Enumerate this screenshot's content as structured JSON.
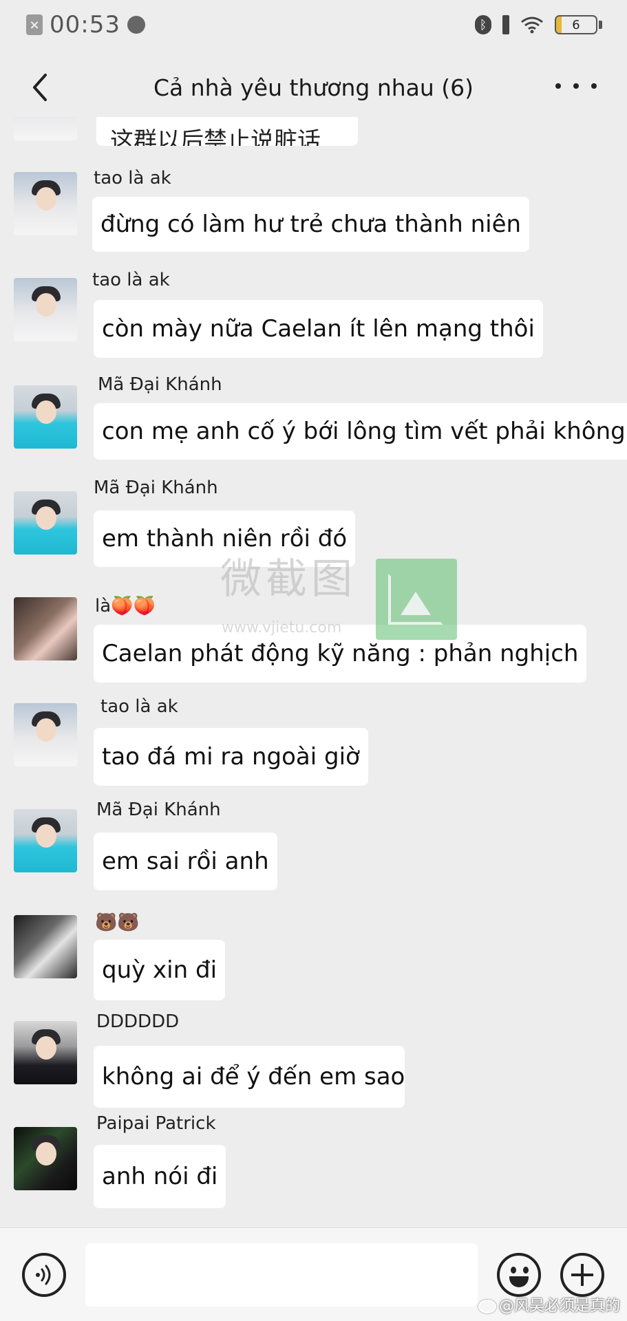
{
  "status_bar": {
    "time": "00:53",
    "battery": "6"
  },
  "nav": {
    "title": "Cả nhà yêu thương nhau (6)"
  },
  "partial_top_message": "这群以后禁止说脏话",
  "messages": [
    {
      "sender": "tao là ak",
      "text": "đừng có làm hư trẻ chưa thành niên",
      "avatar": "boy-white-shirt"
    },
    {
      "sender": "tao là ak",
      "text": "còn mày nữa  Caelan  ít lên mạng thôi",
      "avatar": "boy-white-shirt"
    },
    {
      "sender": "Mã Đại Khánh",
      "text": "con mẹ anh cố ý bới lông tìm vết phải không",
      "avatar": "boy-cyan-hoodie"
    },
    {
      "sender": "Mã Đại Khánh",
      "text": "em thành niên rồi đó",
      "avatar": "boy-cyan-hoodie"
    },
    {
      "sender": "là🍑🍑",
      "text": "Caelan phát động kỹ năng : phản nghịch",
      "avatar": "girl-selfie"
    },
    {
      "sender": "tao là ak",
      "text": "tao đá mi ra ngoài giờ",
      "avatar": "boy-white-shirt"
    },
    {
      "sender": "Mã Đại Khánh",
      "text": "em sai rồi anh",
      "avatar": "boy-cyan-hoodie"
    },
    {
      "sender": "🐻🐻",
      "text": "quỳ xin đi",
      "avatar": "boy-black-white"
    },
    {
      "sender": "DDDDDD",
      "text": "không ai để ý đến em sao",
      "avatar": "boy-dark-sweater"
    },
    {
      "sender": "Paipai Patrick",
      "text": "anh nói đi",
      "avatar": "boy-green-dark"
    }
  ],
  "watermark": {
    "text": "微截图",
    "url": "www.vjietu.com"
  },
  "input": {
    "placeholder": ""
  },
  "credit": "@风昊必须是真的",
  "colors": {
    "background": "#ededed",
    "bubble": "#ffffff",
    "input_bar": "#f6f6f6"
  },
  "icons": [
    "back-icon",
    "more-icon",
    "voice-icon",
    "emoji-icon",
    "plus-icon"
  ]
}
